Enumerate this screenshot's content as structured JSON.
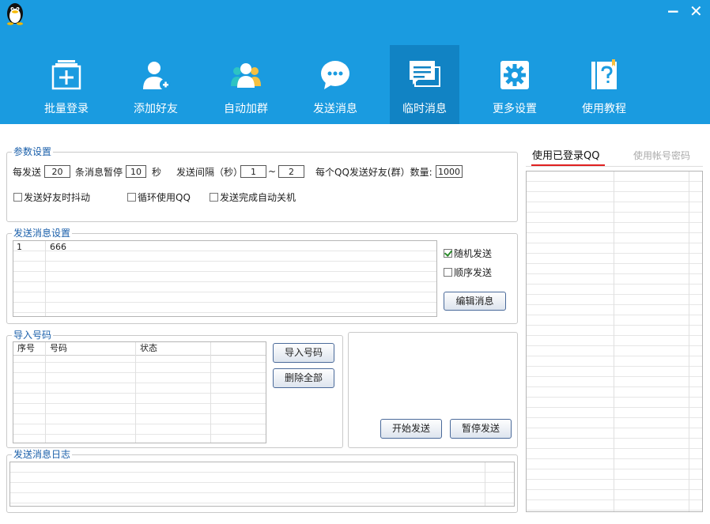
{
  "window": {
    "minimize_glyph": "−",
    "close_glyph": "✕"
  },
  "nav": [
    {
      "label": "批量登录",
      "icon": "batch-login-icon"
    },
    {
      "label": "添加好友",
      "icon": "add-friend-icon"
    },
    {
      "label": "自动加群",
      "icon": "auto-join-group-icon"
    },
    {
      "label": "发送消息",
      "icon": "send-message-icon"
    },
    {
      "label": "临时消息",
      "icon": "temp-message-icon",
      "active": true
    },
    {
      "label": "更多设置",
      "icon": "gear-icon"
    },
    {
      "label": "使用教程",
      "icon": "help-book-icon"
    }
  ],
  "params": {
    "title": "参数设置",
    "per_send_label": "每发送",
    "per_send_value": "20",
    "pause_label": "条消息暂停",
    "pause_value": "10",
    "seconds_label": "秒",
    "interval_label": "发送间隔（秒）",
    "interval_min": "1",
    "tilde": "~",
    "interval_max": "2",
    "count_label": "每个QQ发送好友(群）数量:",
    "count_value": "1000",
    "opt_shake": "发送好友时抖动",
    "opt_loop": "循环使用QQ",
    "opt_shutdown": "发送完成自动关机"
  },
  "msgset": {
    "title": "发送消息设置",
    "rows": [
      {
        "num": "1",
        "text": "666"
      }
    ],
    "random_label": "随机发送",
    "random_checked": true,
    "order_label": "顺序发送",
    "order_checked": false,
    "edit_button": "编辑消息"
  },
  "import": {
    "title": "导入号码",
    "col_index": "序号",
    "col_number": "号码",
    "col_status": "状态",
    "import_button": "导入号码",
    "delete_button": "删除全部"
  },
  "control": {
    "start_button": "开始发送",
    "pause_button": "暂停发送"
  },
  "log": {
    "title": "发送消息日志"
  },
  "right": {
    "tab_logged": "使用已登录QQ",
    "tab_password": "使用帐号密码",
    "accent": "#e02020"
  },
  "colors": {
    "topbar": "#1a9be0",
    "active_tab": "#1183c4",
    "group_title": "#1a5faa"
  }
}
